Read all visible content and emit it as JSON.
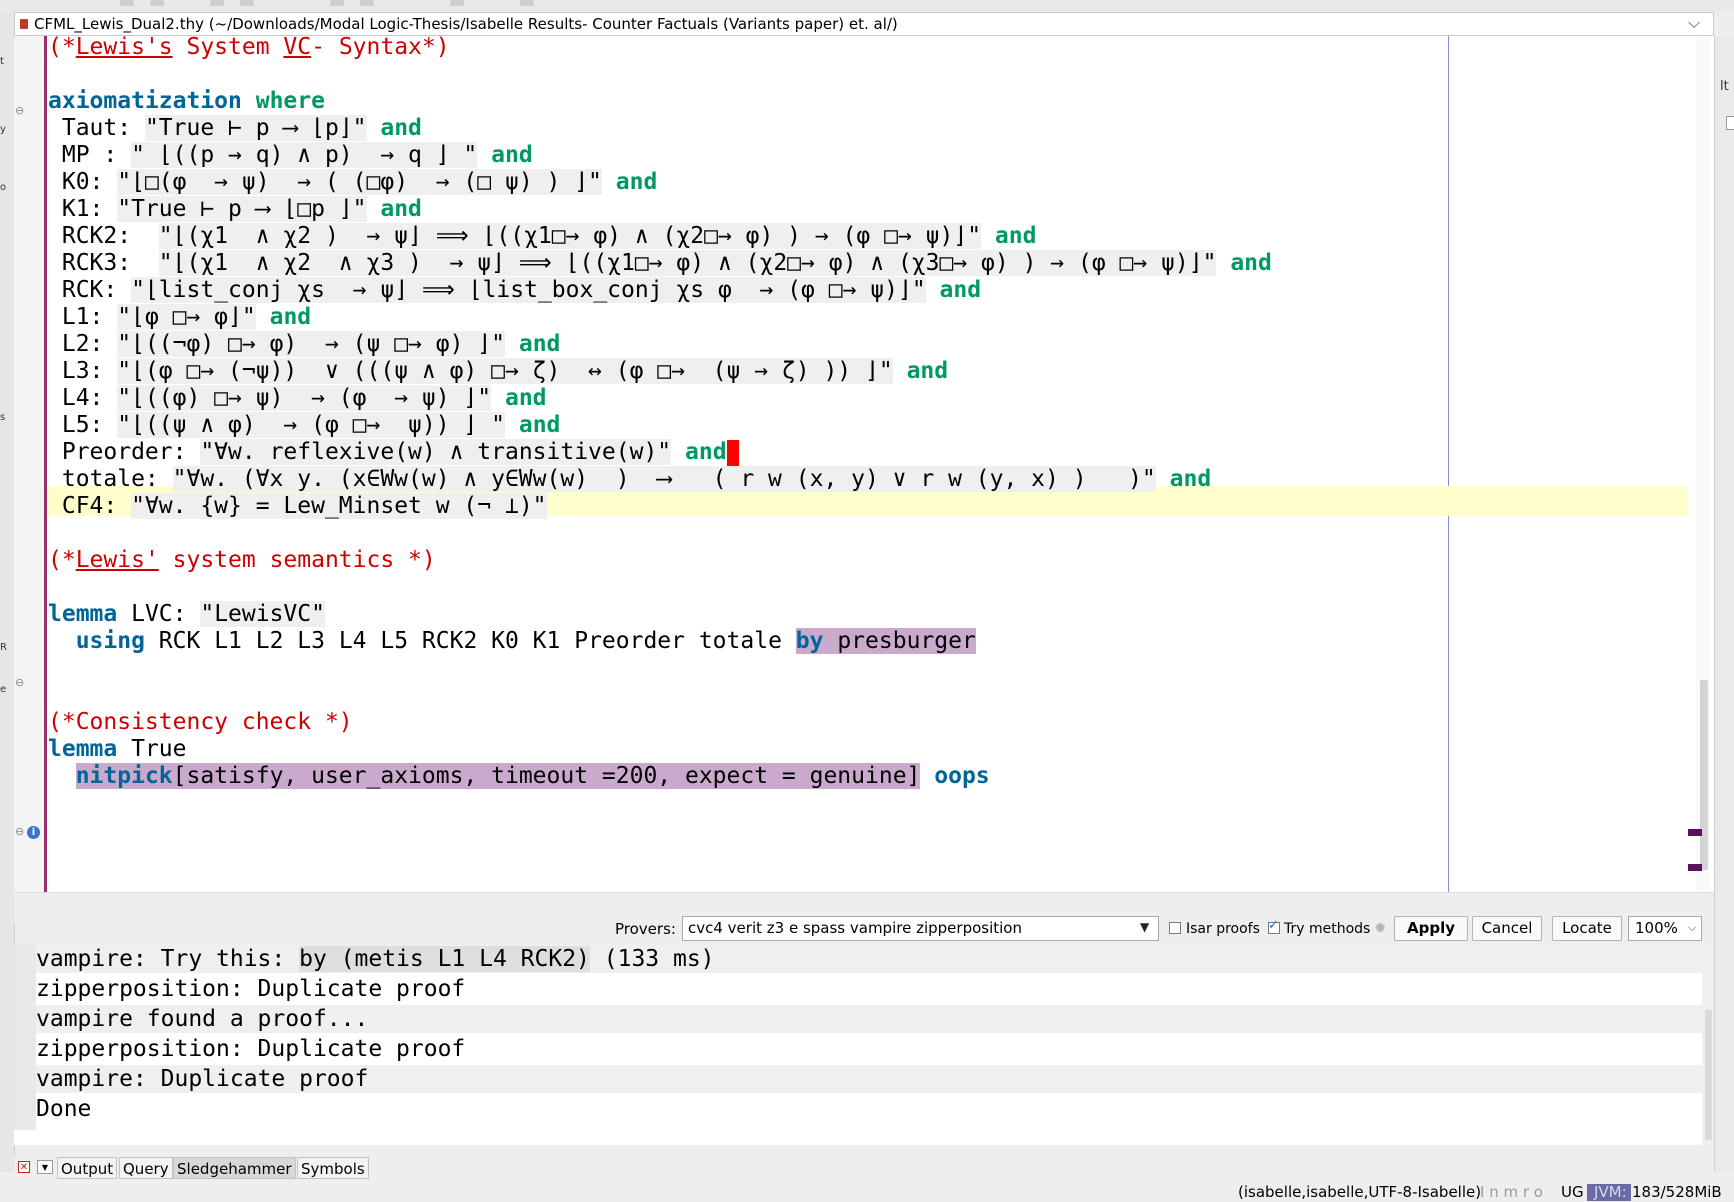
{
  "window": {
    "file_title": "CFML_Lewis_Dual2.thy (~/Downloads/Modal Logic-Thesis/Isabelle Results- Counter Factuals (Variants paper) et. al/)"
  },
  "side_labels": {
    "right": "lt",
    "left": [
      "t",
      "y",
      "o",
      "s",
      "R",
      "e"
    ]
  },
  "editor": {
    "lines": [
      [
        [
          "cm",
          "(*"
        ],
        [
          "cm-u",
          "Lewis's"
        ],
        [
          "cm",
          " System "
        ],
        [
          "cm-u",
          "VC"
        ],
        [
          "cm",
          "- Syntax*)"
        ]
      ],
      [],
      [
        [
          "kw",
          "axiomatization"
        ],
        [
          "p",
          " "
        ],
        [
          "kw2",
          "where"
        ]
      ],
      [
        [
          "p",
          " Taut: "
        ],
        [
          "q",
          "\"True ⊢ p ⟶ ⌊p⌋\""
        ],
        [
          "p",
          " "
        ],
        [
          "kw2",
          "and"
        ]
      ],
      [
        [
          "p",
          " MP : "
        ],
        [
          "q",
          "\" ⌊((p → q) ∧ p)  → q ⌋ \""
        ],
        [
          "p",
          " "
        ],
        [
          "kw2",
          "and"
        ]
      ],
      [
        [
          "p",
          " K0: "
        ],
        [
          "q",
          "\"⌊□(φ  → ψ)  → ( (□φ)  → (□ ψ) ) ⌋\""
        ],
        [
          "p",
          " "
        ],
        [
          "kw2",
          "and"
        ]
      ],
      [
        [
          "p",
          " K1: "
        ],
        [
          "q",
          "\"True ⊢ p ⟶ ⌊□p ⌋\""
        ],
        [
          "p",
          " "
        ],
        [
          "kw2",
          "and"
        ]
      ],
      [
        [
          "p",
          " RCK2:  "
        ],
        [
          "q",
          "\"⌊(χ1  ∧ χ2 )  → ψ⌋ ⟹ ⌊((χ1□→ φ) ∧ (χ2□→ φ) ) → (φ □→ ψ)⌋\""
        ],
        [
          "p",
          " "
        ],
        [
          "kw2",
          "and"
        ]
      ],
      [
        [
          "p",
          " RCK3:  "
        ],
        [
          "q",
          "\"⌊(χ1  ∧ χ2  ∧ χ3 )  → ψ⌋ ⟹ ⌊((χ1□→ φ) ∧ (χ2□→ φ) ∧ (χ3□→ φ) ) → (φ □→ ψ)⌋\""
        ],
        [
          "p",
          " "
        ],
        [
          "kw2",
          "and"
        ]
      ],
      [
        [
          "p",
          " RCK: "
        ],
        [
          "q",
          "\"⌊list_conj χs  → ψ⌋ ⟹ ⌊list_box_conj χs φ  → (φ □→ ψ)⌋\""
        ],
        [
          "p",
          " "
        ],
        [
          "kw2",
          "and"
        ]
      ],
      [
        [
          "p",
          " L1: "
        ],
        [
          "q",
          "\"⌊φ □→ φ⌋\""
        ],
        [
          "p",
          " "
        ],
        [
          "kw2",
          "and"
        ]
      ],
      [
        [
          "p",
          " L2: "
        ],
        [
          "q",
          "\"⌊((¬φ) □→ φ)  → (ψ □→ φ) ⌋\""
        ],
        [
          "p",
          " "
        ],
        [
          "kw2",
          "and"
        ]
      ],
      [
        [
          "p",
          " L3: "
        ],
        [
          "q",
          "\"⌊(φ □→ (¬ψ))  ∨ (((ψ ∧ φ) □→ ζ)  ↔ (φ □→  (ψ → ζ) )) ⌋\""
        ],
        [
          "p",
          " "
        ],
        [
          "kw2",
          "and"
        ]
      ],
      [
        [
          "p",
          " L4: "
        ],
        [
          "q",
          "\"⌊((φ) □→ ψ)  → (φ  → ψ) ⌋\""
        ],
        [
          "p",
          " "
        ],
        [
          "kw2",
          "and"
        ]
      ],
      [
        [
          "p",
          " L5: "
        ],
        [
          "q",
          "\"⌊((ψ ∧ φ)  → (φ □→  ψ)) ⌋ \""
        ],
        [
          "p",
          " "
        ],
        [
          "kw2",
          "and"
        ]
      ],
      [
        [
          "p",
          " Preorder: "
        ],
        [
          "q",
          "\"∀w. reflexive(w) ∧ transitive(w)\""
        ],
        [
          "p",
          " "
        ],
        [
          "kw2",
          "and"
        ],
        [
          "cur",
          ""
        ]
      ],
      [
        [
          "p",
          " totale: "
        ],
        [
          "q",
          "\"∀w. (∀x y. (x∈Ww(w) ∧ y∈Ww(w)  )  ⟶   ( r w (x, y) ∨ r w (y, x) )   )\""
        ],
        [
          "p",
          " "
        ],
        [
          "kw2",
          "and"
        ]
      ],
      [
        [
          "p",
          " CF4: "
        ],
        [
          "q",
          "\"∀w. {w} = Lew_Minset w (¬ ⊥)\""
        ]
      ],
      [],
      [
        [
          "cm",
          "(*"
        ],
        [
          "cm-u",
          "Lewis'"
        ],
        [
          "cm",
          " system semantics *)"
        ]
      ],
      [],
      [
        [
          "kw",
          "lemma"
        ],
        [
          "p",
          " LVC: "
        ],
        [
          "q",
          "\"LewisVC\""
        ]
      ],
      [
        [
          "p",
          "  "
        ],
        [
          "kw",
          "using"
        ],
        [
          "p",
          " RCK L1 L2 L3 L4 L5 RCK2 K0 K1 Preorder totale "
        ],
        [
          "pvk",
          "by"
        ],
        [
          "pv",
          " presburger"
        ]
      ],
      [],
      [],
      [
        [
          "cm",
          "(*Consistency check *)"
        ]
      ],
      [
        [
          "kw",
          "lemma"
        ],
        [
          "p",
          " True"
        ]
      ],
      [
        [
          "p",
          "  "
        ],
        [
          "pvk",
          "nitpick"
        ],
        [
          "pv",
          "[satisfy, user_axioms, timeout =200, expect = genuine]"
        ],
        [
          "p",
          " "
        ],
        [
          "kw",
          "oops"
        ]
      ]
    ]
  },
  "sledgehammer": {
    "provers_label": "Provers:",
    "provers_value": "cvc4 verit z3 e spass vampire zipperposition",
    "isar_proofs_label": "Isar proofs",
    "isar_proofs_checked": false,
    "try_methods_label": "Try methods",
    "try_methods_checked": true,
    "apply_label": "Apply",
    "cancel_label": "Cancel",
    "locate_label": "Locate",
    "zoom": "100%"
  },
  "output": {
    "line1_prefix": "vampire: Try this: ",
    "line1_proof": "by (metis L1 L4 RCK2)",
    "line1_suffix": " (133 ms)",
    "lines": [
      "zipperposition: Duplicate proof",
      "vampire found a proof...",
      "zipperposition: Duplicate proof",
      "vampire: Duplicate proof",
      "Done"
    ]
  },
  "dock_tabs": [
    "Output",
    "Query",
    "Sledgehammer",
    "Symbols"
  ],
  "active_tab": "Sledgehammer",
  "status": {
    "encoding": "(isabelle,isabelle,UTF-8-Isabelle)",
    "flags": "I n m r o",
    "ug": "UG",
    "jvm_label": "JVM:",
    "memory": "183/528MiB"
  },
  "colors": {
    "keyword": "#006699",
    "keyword2": "#009966",
    "comment": "#cc0000",
    "proof_highlight": "#c9a9cc",
    "current_line": "#ffffcc"
  }
}
